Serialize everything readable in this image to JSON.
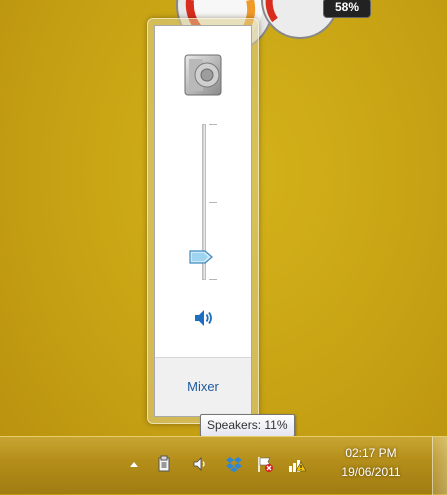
{
  "gadget": {
    "battery_percent": "58%"
  },
  "volume_flyout": {
    "device_icon": "speaker-device-icon",
    "level_percent": 11,
    "mute_icon": "speaker-volume-icon",
    "mixer_label": "Mixer"
  },
  "tooltip": {
    "text": "Speakers: 11%"
  },
  "taskbar": {
    "tray_icons": [
      "show-hidden-icons-arrow-icon",
      "safely-remove-hardware-icon",
      "volume-icon",
      "dropbox-icon",
      "action-center-flag-icon",
      "network-warning-icon"
    ],
    "clock": {
      "time": "02:17 PM",
      "date": "19/06/2011"
    }
  },
  "colors": {
    "desktop": "#c9a515",
    "link": "#1e5a9e",
    "taskbar": "#b58f1a"
  }
}
